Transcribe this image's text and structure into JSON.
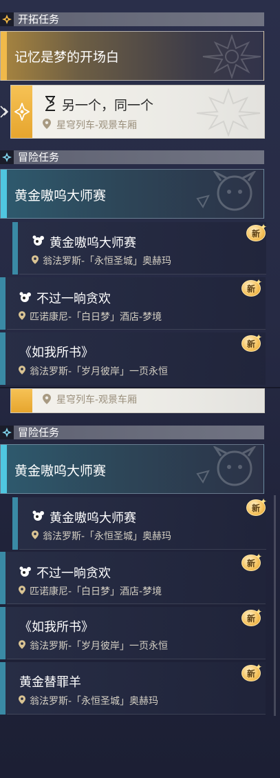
{
  "top": {
    "trailblaze_header": "开拓任务",
    "trailblaze_main": "记忆是梦的开场白",
    "selected_quest": {
      "title": "另一个，同一个",
      "location": "星穹列车-观景车厢"
    },
    "adventure_header": "冒险任务",
    "adventure_main": "黄金嗷呜大师赛",
    "items": [
      {
        "title": "黄金嗷呜大师赛",
        "location": "翁法罗斯-「永恒圣城」奥赫玛",
        "new": "新"
      },
      {
        "title": "不过一晌贪欢",
        "location": "匹诺康尼-「白日梦」酒店-梦境",
        "new": "新"
      },
      {
        "title": "《如我所书》",
        "location": "翁法罗斯-「岁月彼岸」一页永恒",
        "new": "新"
      }
    ]
  },
  "bottom": {
    "selected_location": "星穹列车-观景车厢",
    "adventure_header": "冒险任务",
    "adventure_main": "黄金嗷呜大师赛",
    "items": [
      {
        "title": "黄金嗷呜大师赛",
        "location": "翁法罗斯-「永恒圣城」奥赫玛",
        "new": "新"
      },
      {
        "title": "不过一晌贪欢",
        "location": "匹诺康尼-「白日梦」酒店-梦境",
        "new": "新"
      },
      {
        "title": "《如我所书》",
        "location": "翁法罗斯-「岁月彼岸」一页永恒",
        "new": "新"
      },
      {
        "title": "黄金替罪羊",
        "location": "翁法罗斯-「永恒圣城」奥赫玛",
        "new": "新"
      }
    ]
  },
  "colors": {
    "trailblaze_accent": "#f0b94a",
    "adventure_accent": "#4fc6e0",
    "item_bar": "#3a8aa5"
  },
  "icons": [
    "trailblaze-diamond-icon",
    "adventure-diamond-icon",
    "hourglass-icon",
    "location-pin-icon",
    "wolf-head-icon",
    "new-badge-icon",
    "arrow-pointer-icon"
  ]
}
